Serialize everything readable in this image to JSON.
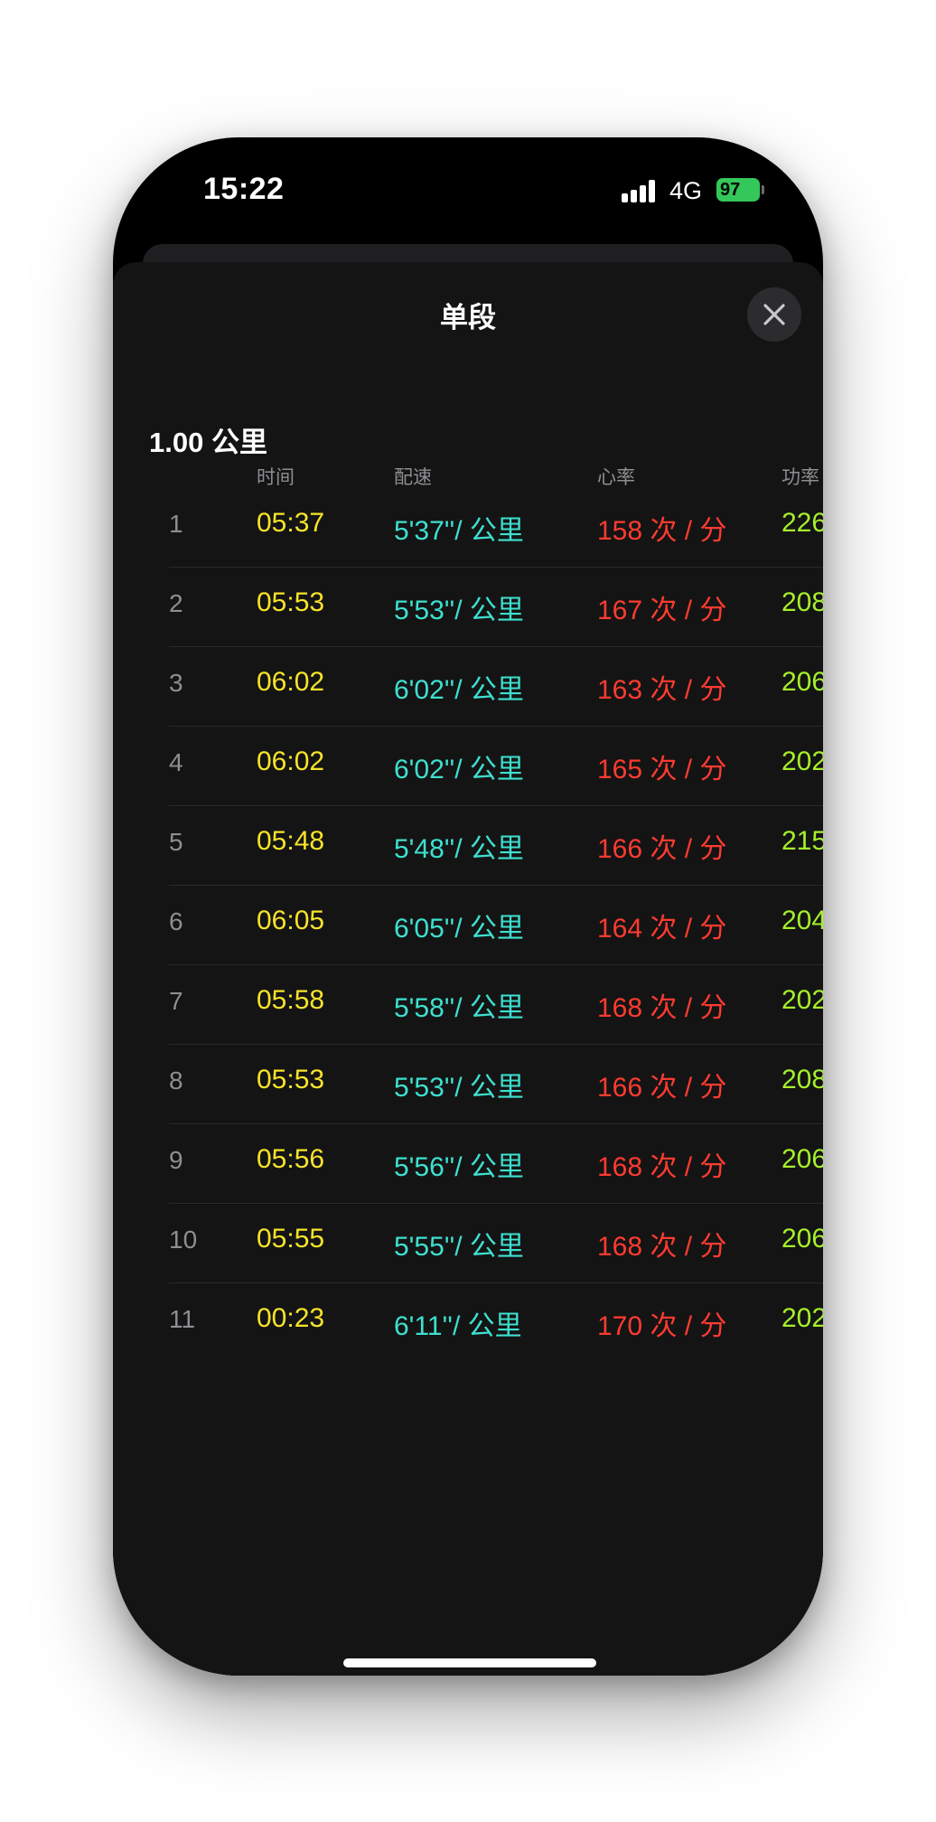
{
  "status_bar": {
    "time": "15:22",
    "network": "4G",
    "battery": "97"
  },
  "sheet": {
    "title": "单段",
    "section_title": "1.00 公里"
  },
  "columns": [
    "时间",
    "配速",
    "心率",
    "功率"
  ],
  "colors": {
    "time": "#f7e32a",
    "pace": "#3ee0d0",
    "heart_rate": "#ff3b30",
    "power": "#a6f02a",
    "index": "#8e8e93",
    "battery": "#34c759"
  },
  "rows": [
    {
      "index": "1",
      "time": "05:37",
      "pace": "5'37''/ 公里",
      "heart_rate": "158 次 / 分",
      "power": "226"
    },
    {
      "index": "2",
      "time": "05:53",
      "pace": "5'53''/ 公里",
      "heart_rate": "167 次 / 分",
      "power": "208"
    },
    {
      "index": "3",
      "time": "06:02",
      "pace": "6'02''/ 公里",
      "heart_rate": "163 次 / 分",
      "power": "206"
    },
    {
      "index": "4",
      "time": "06:02",
      "pace": "6'02''/ 公里",
      "heart_rate": "165 次 / 分",
      "power": "202"
    },
    {
      "index": "5",
      "time": "05:48",
      "pace": "5'48''/ 公里",
      "heart_rate": "166 次 / 分",
      "power": "215"
    },
    {
      "index": "6",
      "time": "06:05",
      "pace": "6'05''/ 公里",
      "heart_rate": "164 次 / 分",
      "power": "204"
    },
    {
      "index": "7",
      "time": "05:58",
      "pace": "5'58''/ 公里",
      "heart_rate": "168 次 / 分",
      "power": "202"
    },
    {
      "index": "8",
      "time": "05:53",
      "pace": "5'53''/ 公里",
      "heart_rate": "166 次 / 分",
      "power": "208"
    },
    {
      "index": "9",
      "time": "05:56",
      "pace": "5'56''/ 公里",
      "heart_rate": "168 次 / 分",
      "power": "206"
    },
    {
      "index": "10",
      "time": "05:55",
      "pace": "5'55''/ 公里",
      "heart_rate": "168 次 / 分",
      "power": "206"
    },
    {
      "index": "11",
      "time": "00:23",
      "pace": "6'11''/ 公里",
      "heart_rate": "170 次 / 分",
      "power": "202"
    }
  ]
}
